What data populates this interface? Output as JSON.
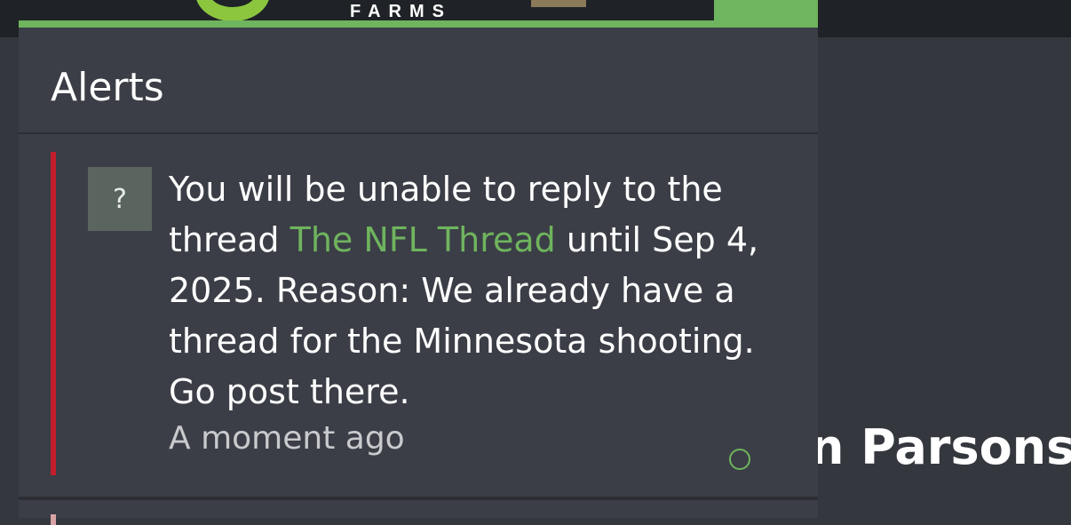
{
  "header": {
    "logo_text": "FARMS"
  },
  "background": {
    "title_fragment": "n Parsons"
  },
  "alerts": {
    "title": "Alerts",
    "items": [
      {
        "avatar_text": "?",
        "message_before": "You will be unable to reply to the thread ",
        "thread_link": "The NFL Thread",
        "message_after": " until Sep 4, 2025. Reason: We already have a thread for the Minnesota shooting. Go post there.",
        "time": "A moment ago",
        "unread": true
      }
    ]
  },
  "colors": {
    "accent_green": "#6fb45e",
    "alert_bar_red": "#c41e2b",
    "panel_bg": "#3b3e46",
    "page_bg": "#34373e"
  },
  "icons": {
    "logo": "logo-ring-icon",
    "mark_read": "mark-read-circle-icon"
  }
}
